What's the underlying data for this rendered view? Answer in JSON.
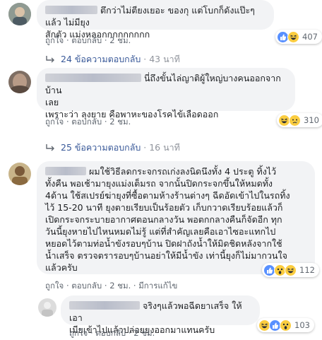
{
  "comments": [
    {
      "text_line1": "ตึกว่าไม่ตียงเยอะ ของกุ แต่โบกก็ดังแป๊ะๆแล้ว ไม่มียุง",
      "text_line2": "สักตัว แม่งหลอกกกกกกกกก",
      "reaction_count": "407",
      "like": "ถูกใจ",
      "reply": "ตอบกลับ",
      "time": "2 ชม."
    },
    {
      "name_partial": "นี่ถึงขั้นไล่ญาติผู้ใหญ่บางคนออกจากบ้าน",
      "text_line1": "เลย",
      "text_line2": "เพราะว่า ลุงยาย คือพาหะของโรคไข้เลือดออก",
      "reaction_count": "310",
      "like": "ถูกใจ",
      "reply": "ตอบกลับ",
      "time": "2 ชม."
    },
    {
      "lines": [
        "ผมใช้วิธีลดกระจกรถเก่งลงนิดนึงทั้ง 4 ประตู ทิ้งไว้",
        "ทั้งคืน พอเช้ามายุงแม่งเต็มรถ จากนั้นปิดกระจกขึ้นให้หมดทั้ง",
        "4ด้าน ใช้สเปรย์ฆ่ายุงที่ซื้อตามห้างร้านต่างๆ ฉีดอัดเข้าไปในรถทิ้ง",
        "ไว้ 15-20 นาที ยุงตายเรียบเป็นร้อยตัว เก็บกวาดเรียบร้อยแล้วก็",
        "เปิดกระจกระบายอากาศตอนกลางวัน พอตกกลางคืนก็จัดอีก ทุก",
        "วันนี้ยุงหายไปไหนหมดไม่รู้ แต่ที่สำคัญเลยคือเอาไซอะแทกไป",
        "หยอดไว้ตามท่อน้ำขังรอบๆบ้าน ปิดฝาถังน้ำให้มิดชิดหลังจากใช้",
        "น้ำเสร็จ ตรวจตรารอบๆบ้านอย่าให้มีน้ำขัง เท่านี้ยุงก็ไม่มากวนใจ",
        "แล้วครับ"
      ],
      "reaction_count": "112",
      "like": "ถูกใจ",
      "reply": "ตอบกลับ",
      "time": "2 ชม.",
      "edited": "มีการแก้ไข"
    },
    {
      "line1_partial": "จริงๆแล้วพอฉีดยาเสร็จ ให้เอา",
      "line2": "เมียเข้าไปแล้วปล่อยยุงออกมาแทนครับ",
      "reaction_count": "103",
      "like": "ถูกใจ",
      "reply": "ตอบกลับ",
      "time": "2 ชม."
    }
  ],
  "reply_threads": [
    {
      "label": "24 ข้อความตอบกลับ",
      "time": "43 นาที"
    },
    {
      "label": "25 ข้อความตอบกลับ",
      "time": "16 นาที"
    }
  ],
  "colors": {
    "link": "#385898",
    "bubble": "#f2f3f5",
    "muted": "#606770"
  }
}
